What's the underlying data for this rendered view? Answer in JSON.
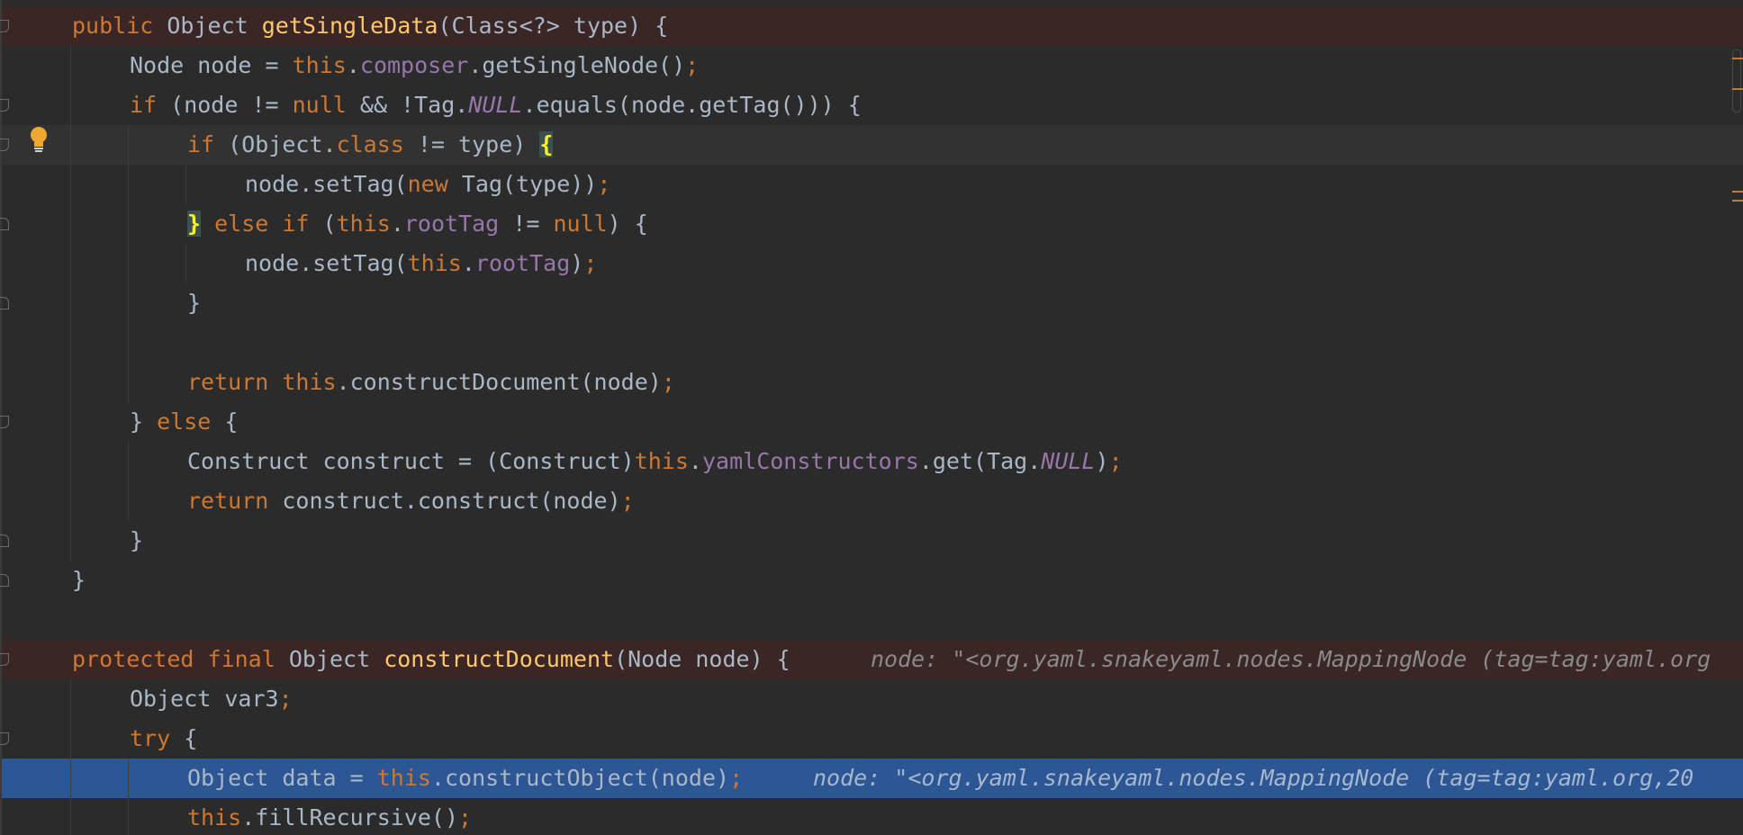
{
  "editor": {
    "lines": {
      "l1": {
        "t1": "public ",
        "t2": "Object ",
        "t3": "getSingleData",
        "t4": "(Class<?> type) {"
      },
      "l2": {
        "t1": "Node node = ",
        "t2": "this",
        "t3": ".",
        "t4": "composer",
        "t5": ".getSingleNode()",
        "t6": ";"
      },
      "l3": {
        "t1": "if ",
        "t2": "(node != ",
        "t3": "null ",
        "t4": "&& !Tag.",
        "t5": "NULL",
        "t6": ".equals(node.getTag())) {"
      },
      "l4": {
        "t1": "if ",
        "t2": "(Object.",
        "t3": "class ",
        "t4": "!= type) ",
        "t5": "{"
      },
      "l5": {
        "t1": "node.setTag(",
        "t2": "new ",
        "t3": "Tag(type))",
        "t4": ";"
      },
      "l6": {
        "t1": "}",
        "t2": " else if ",
        "t3": "(",
        "t4": "this",
        "t5": ".",
        "t6": "rootTag",
        "t7": " != ",
        "t8": "null",
        "t9": ") {"
      },
      "l7": {
        "t1": "node.setTag(",
        "t2": "this",
        "t3": ".",
        "t4": "rootTag",
        "t5": ")",
        "t6": ";"
      },
      "l8": {
        "t1": "}"
      },
      "l10": {
        "t1": "return ",
        "t2": "this",
        "t3": ".constructDocument(node)",
        "t4": ";"
      },
      "l11": {
        "t1": "} ",
        "t2": "else ",
        "t3": "{"
      },
      "l12": {
        "t1": "Construct construct = (Construct)",
        "t2": "this",
        "t3": ".",
        "t4": "yamlConstructors",
        "t5": ".get(Tag.",
        "t6": "NULL",
        "t7": ")",
        "t8": ";"
      },
      "l13": {
        "t1": "return ",
        "t2": "construct.construct(node)",
        "t3": ";"
      },
      "l14": {
        "t1": "}"
      },
      "l15": {
        "t1": "}"
      },
      "l17": {
        "t1": "protected ",
        "t2": "final ",
        "t3": "Object ",
        "t4": "constructDocument",
        "t5": "(Node node) {",
        "hint": "node: \"<org.yaml.snakeyaml.nodes.MappingNode (tag=tag:yaml.org"
      },
      "l18": {
        "t1": "Object var3",
        "t2": ";"
      },
      "l19": {
        "t1": "try ",
        "t2": "{"
      },
      "l20": {
        "t1": "Object data = ",
        "t2": "this",
        "t3": ".constructObject(node)",
        "t4": ";",
        "hint": "node: \"<org.yaml.snakeyaml.nodes.MappingNode (tag=tag:yaml.org,20"
      },
      "l21": {
        "t1": "this",
        "t2": ".fillRecursive()",
        "t3": ";"
      }
    }
  },
  "icons": {
    "bulb": "lightbulb-icon",
    "fold": "fold-marker-icon"
  },
  "colors": {
    "background": "#2b2b2b",
    "keyword": "#cc7832",
    "method": "#ffc66d",
    "field": "#9876aa",
    "text": "#a9b7c6",
    "method_highlight": "#3b2626",
    "exec_line": "#2d5794",
    "brace_match": "#3b514d",
    "hint": "#8a8a8a"
  }
}
